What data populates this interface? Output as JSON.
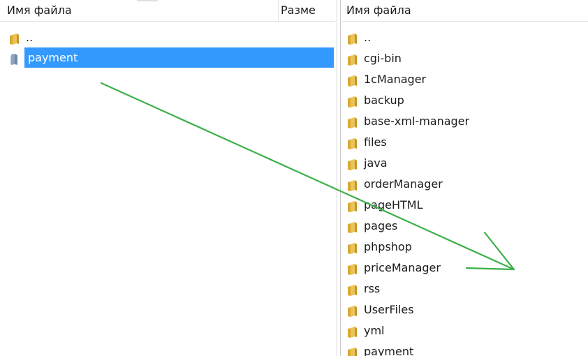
{
  "left_panel": {
    "columns": {
      "name": "Имя файла",
      "size": "Разме"
    },
    "items": [
      {
        "name": "..",
        "selected": false,
        "icon": "folder-up-icon"
      },
      {
        "name": "payment",
        "selected": true,
        "icon": "folder-icon"
      }
    ]
  },
  "right_panel": {
    "columns": {
      "name": "Имя файла"
    },
    "items": [
      {
        "name": "..",
        "icon": "folder-up-icon"
      },
      {
        "name": "cgi-bin",
        "icon": "folder-icon"
      },
      {
        "name": "1cManager",
        "icon": "folder-icon"
      },
      {
        "name": "backup",
        "icon": "folder-icon"
      },
      {
        "name": "base-xml-manager",
        "icon": "folder-icon"
      },
      {
        "name": "files",
        "icon": "folder-icon"
      },
      {
        "name": "java",
        "icon": "folder-icon"
      },
      {
        "name": "orderManager",
        "icon": "folder-icon"
      },
      {
        "name": "pageHTML",
        "icon": "folder-icon"
      },
      {
        "name": "pages",
        "icon": "folder-icon"
      },
      {
        "name": "phpshop",
        "icon": "folder-icon"
      },
      {
        "name": "priceManager",
        "icon": "folder-icon"
      },
      {
        "name": "rss",
        "icon": "folder-icon"
      },
      {
        "name": "UserFiles",
        "icon": "folder-icon"
      },
      {
        "name": "yml",
        "icon": "folder-icon"
      },
      {
        "name": "payment",
        "icon": "folder-icon"
      }
    ]
  },
  "colors": {
    "selection": "#3399ff",
    "annotation_arrow": "#3cb04a",
    "folder": "#e8c45a"
  }
}
